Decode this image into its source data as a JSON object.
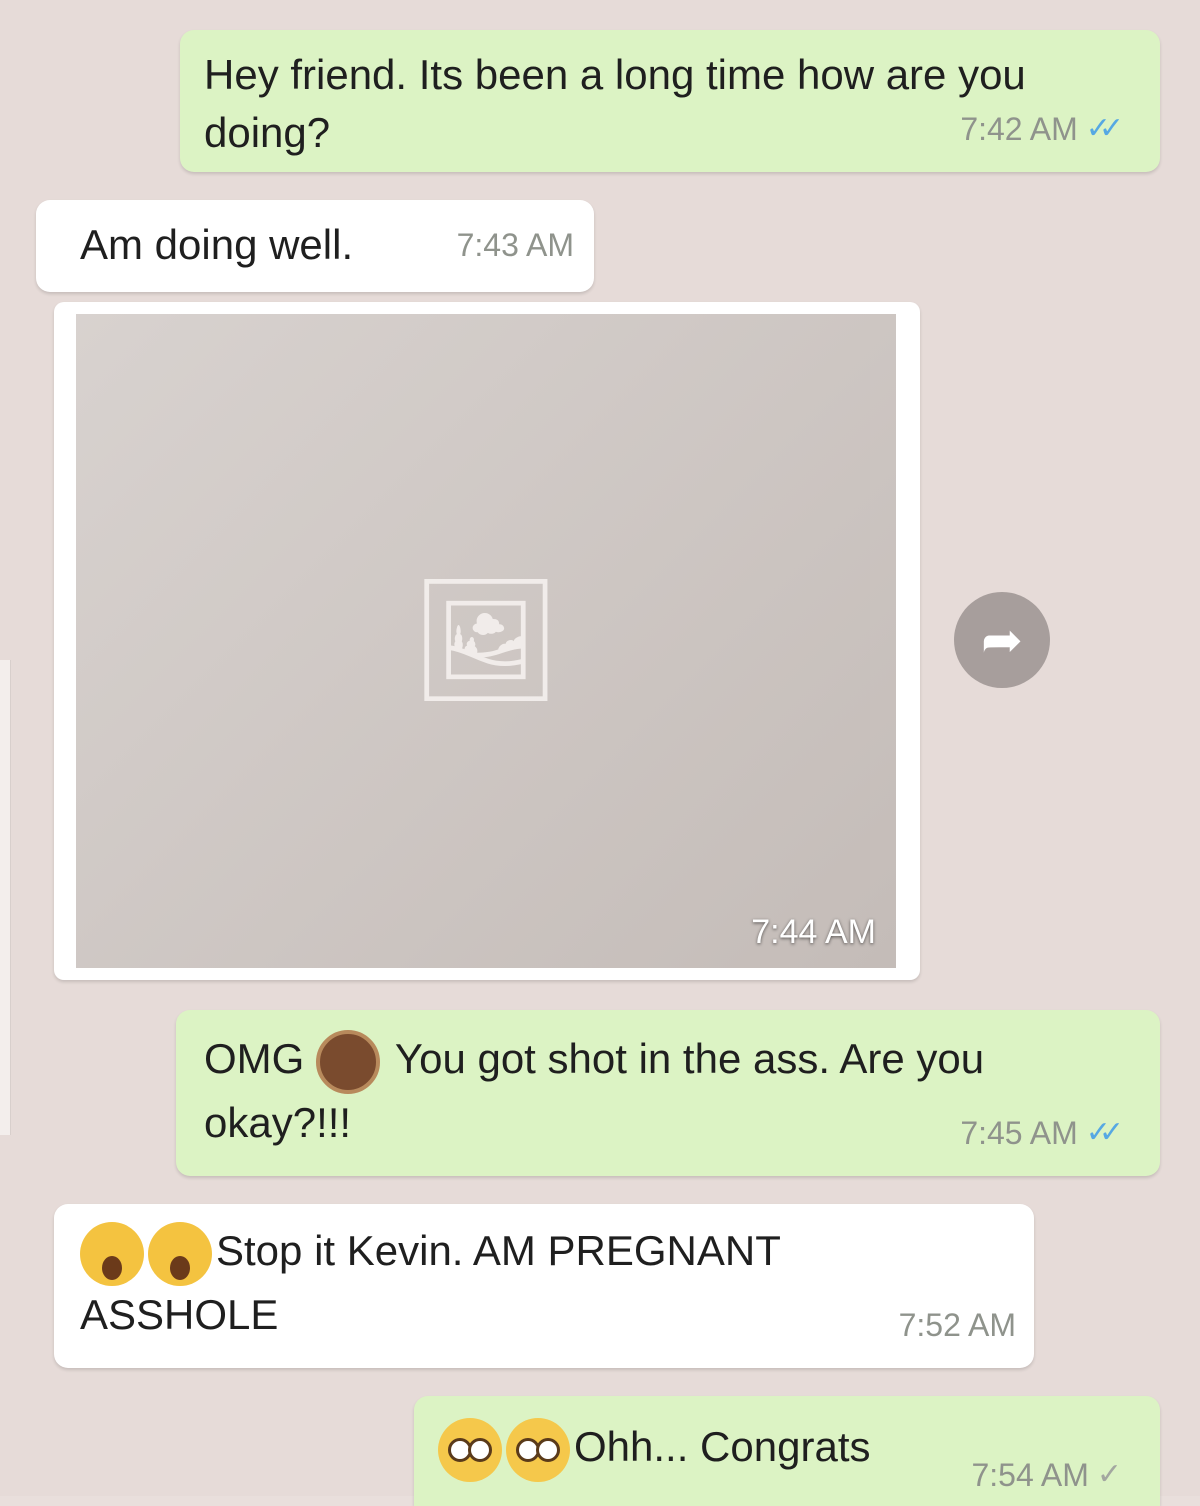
{
  "chat": {
    "messages": [
      {
        "direction": "outgoing",
        "text": "Hey friend. Its been a long time how are you doing?",
        "time": "7:42 AM",
        "status": "read"
      },
      {
        "direction": "incoming",
        "text": "Am doing well.",
        "time": "7:43 AM"
      },
      {
        "direction": "incoming",
        "type": "image",
        "time": "7:44 AM"
      },
      {
        "direction": "outgoing",
        "text_before_emoji": "OMG",
        "emoji": "woman-emoji",
        "text_after_emoji": "You got shot in the ass. Are you okay?!!!",
        "time": "7:45 AM",
        "status": "read"
      },
      {
        "direction": "incoming",
        "emojis": [
          "face-screaming-emoji",
          "face-screaming-emoji"
        ],
        "text": "Stop it Kevin. AM PREGNANT ASSHOLE",
        "time": "7:52 AM"
      },
      {
        "direction": "outgoing",
        "emojis": [
          "flushed-face-emoji",
          "flushed-face-emoji"
        ],
        "text": "Ohh... Congrats",
        "time": "7:54 AM",
        "status": "sent"
      }
    ]
  },
  "icons": {
    "read_ticks": "✓✓",
    "sent_tick": "✓",
    "forward": "➦",
    "photo": "🖼"
  },
  "colors": {
    "outgoing_bubble": "#dcf3c4",
    "incoming_bubble": "#ffffff",
    "read_tick": "#56a8e3",
    "timestamp": "#8f938c"
  }
}
